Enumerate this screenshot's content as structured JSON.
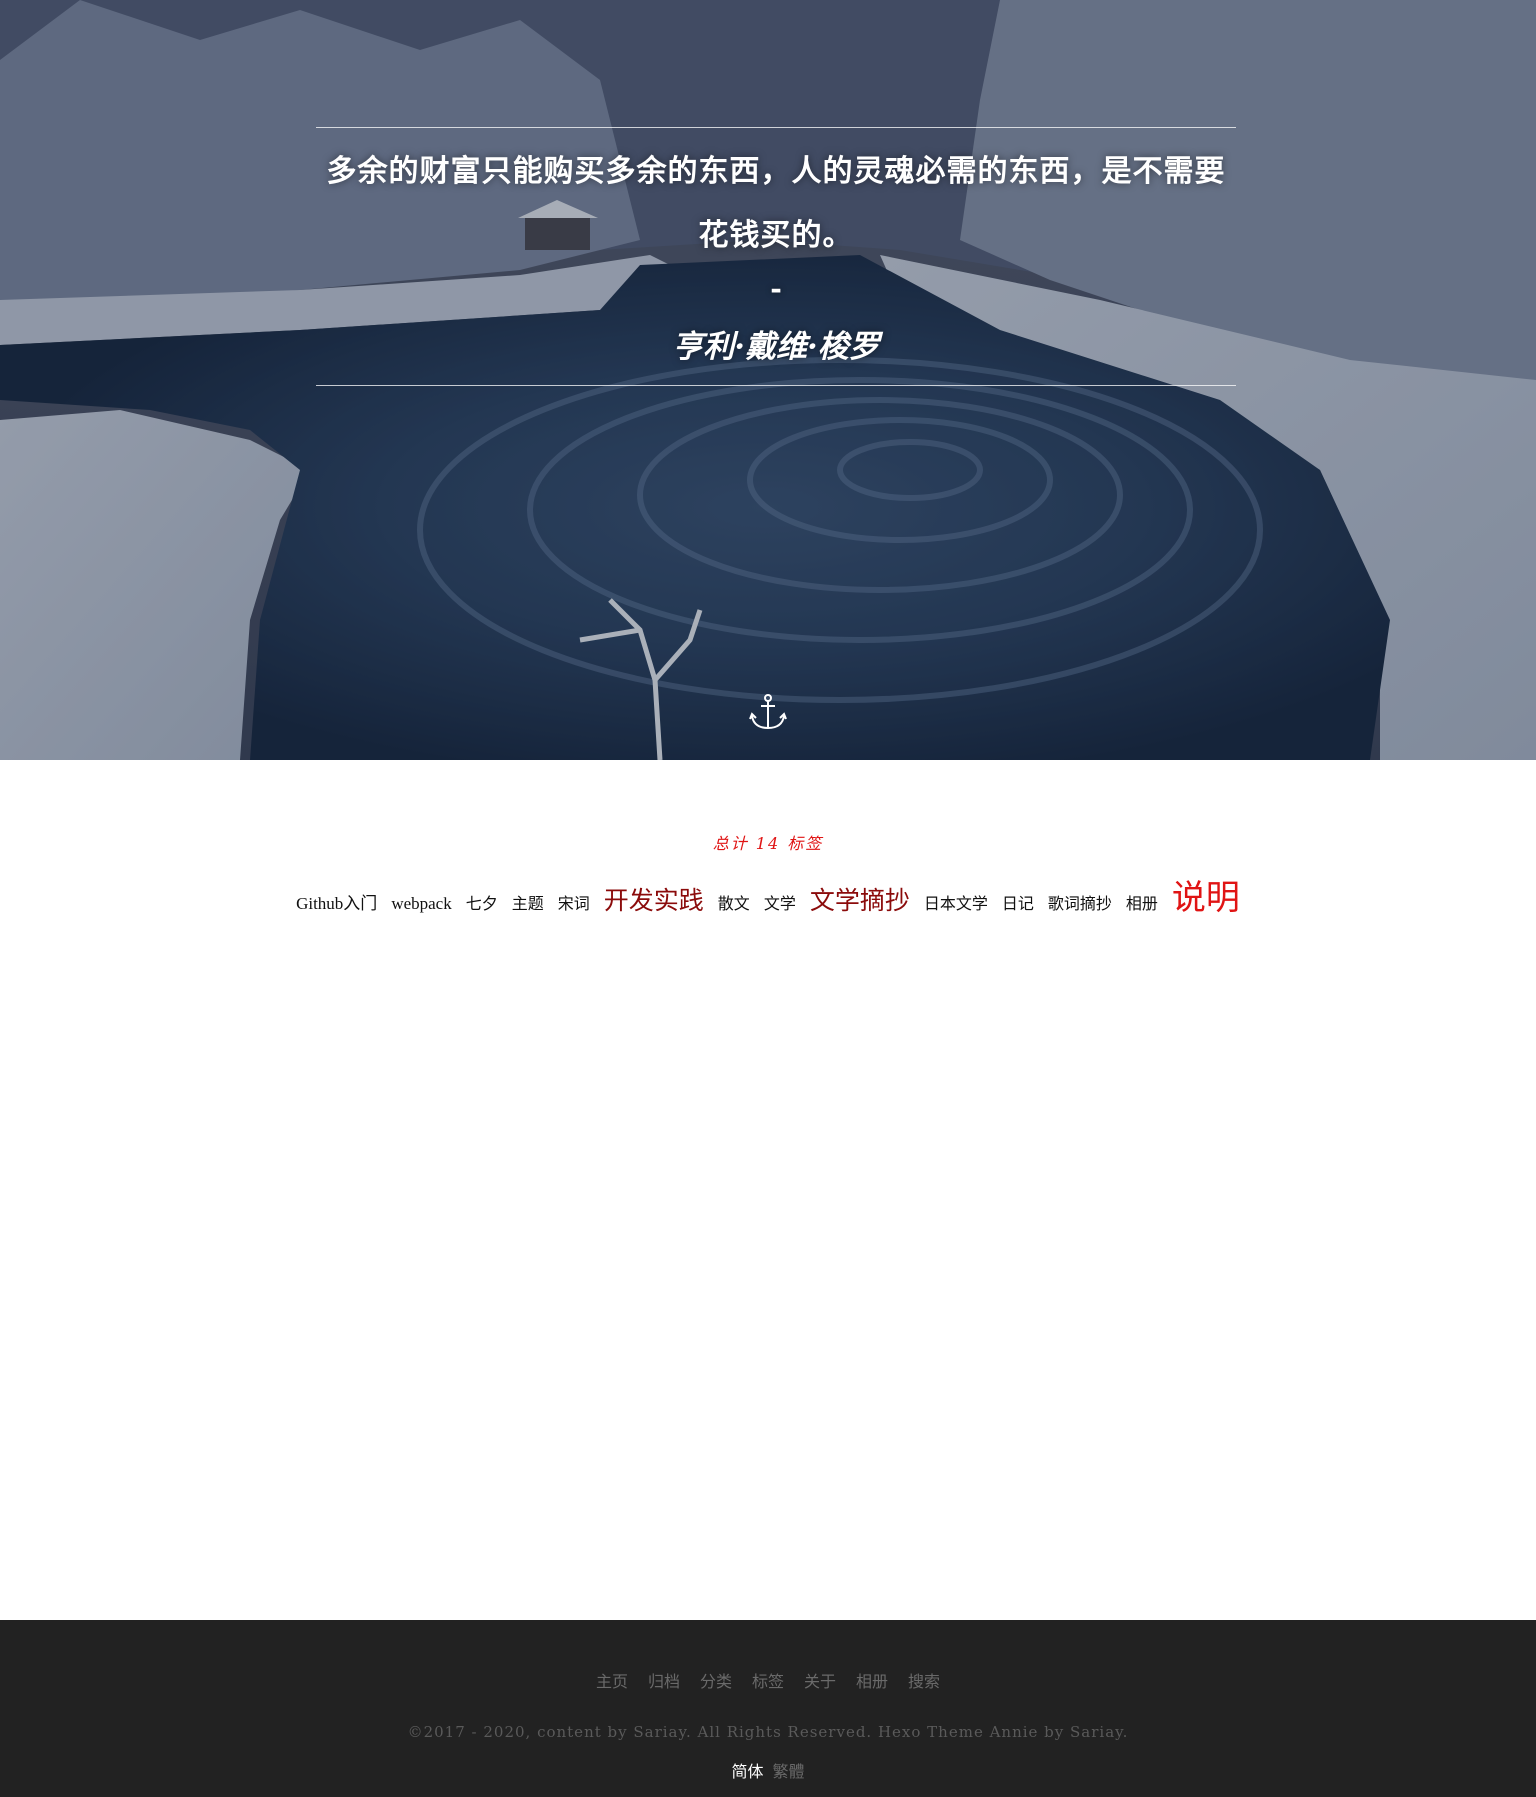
{
  "hero": {
    "quote": "多余的财富只能购买多余的东西，人的灵魂必需的东西，是不需要花钱买的。",
    "dash": "-",
    "author": "亨利·戴维·梭罗",
    "scroll_icon": "anchor-icon"
  },
  "tags": {
    "total_label": "总计 14 标签",
    "items": [
      {
        "label": "Github入门",
        "level": "small"
      },
      {
        "label": "webpack",
        "level": "small"
      },
      {
        "label": "七夕",
        "level": "small"
      },
      {
        "label": "主题",
        "level": "small"
      },
      {
        "label": "宋词",
        "level": "small"
      },
      {
        "label": "开发实践",
        "level": "large"
      },
      {
        "label": "散文",
        "level": "small"
      },
      {
        "label": "文学",
        "level": "small"
      },
      {
        "label": "文学摘抄",
        "level": "large"
      },
      {
        "label": "日本文学",
        "level": "small"
      },
      {
        "label": "日记",
        "level": "small"
      },
      {
        "label": "歌词摘抄",
        "level": "small"
      },
      {
        "label": "相册",
        "level": "small"
      },
      {
        "label": "说明",
        "level": "largest"
      }
    ],
    "colors": {
      "small": "#111111",
      "large": "#8b0b0b",
      "largest": "#e01414"
    }
  },
  "footer": {
    "nav": [
      "主页",
      "归档",
      "分类",
      "标签",
      "关于",
      "相册",
      "搜索"
    ],
    "copyright": "©2017 - 2020, content by Sariay. All Rights Reserved. Hexo Theme Annie by Sariay.",
    "lang": {
      "simplified": "简体",
      "traditional": "繁體",
      "active_color": "#ffffff",
      "inactive_color": "#6a6a6a"
    }
  }
}
